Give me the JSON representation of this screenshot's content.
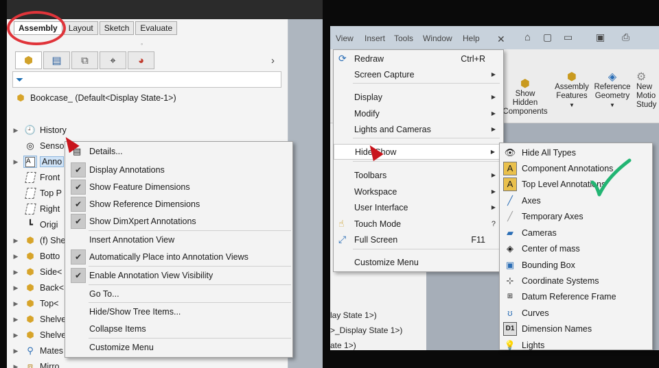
{
  "left": {
    "command_tabs": [
      "Assembly",
      "Layout",
      "Sketch",
      "Evaluate"
    ],
    "active_tab": "Assembly",
    "fm_tab_icons": [
      "feature-manager-icon",
      "property-manager-icon",
      "configuration-manager-icon",
      "dimxpert-manager-icon",
      "display-manager-icon"
    ],
    "root": "Bookcase_ (Default<Display State-1>)",
    "tree": [
      {
        "label": "History",
        "icon": "history-icon"
      },
      {
        "label": "Sensors",
        "icon": "sensors-icon"
      },
      {
        "label": "Anno",
        "icon": "annotations-icon"
      },
      {
        "label": "Front",
        "icon": "plane-icon"
      },
      {
        "label": "Top P",
        "icon": "plane-icon"
      },
      {
        "label": "Right",
        "icon": "plane-icon"
      },
      {
        "label": "Origi",
        "icon": "origin-icon"
      },
      {
        "label": "(f) She",
        "icon": "part-icon"
      },
      {
        "label": "Botto",
        "icon": "part-icon"
      },
      {
        "label": "Side<",
        "icon": "part-icon"
      },
      {
        "label": "Back<",
        "icon": "part-icon"
      },
      {
        "label": "Top<",
        "icon": "part-icon"
      },
      {
        "label": "Shelve",
        "icon": "part-icon"
      },
      {
        "label": "Shelve",
        "icon": "part-icon"
      },
      {
        "label": "Mates",
        "icon": "mates-icon"
      },
      {
        "label": "Mirro",
        "icon": "mirror-icon"
      }
    ],
    "context_menu": {
      "details": "Details...",
      "display_annotations": "Display Annotations",
      "show_feature_dimensions": "Show Feature Dimensions",
      "show_reference_dimensions": "Show Reference Dimensions",
      "show_dimxpert_annotations": "Show DimXpert Annotations",
      "insert_annotation_view": "Insert Annotation View",
      "auto_place": "Automatically Place into Annotation Views",
      "enable_visibility": "Enable Annotation View Visibility",
      "go_to": "Go To...",
      "hide_show_tree": "Hide/Show Tree Items...",
      "collapse": "Collapse Items",
      "customize": "Customize Menu"
    }
  },
  "right": {
    "menubar": [
      "View",
      "Insert",
      "Tools",
      "Window",
      "Help"
    ],
    "ribbon": {
      "show_hidden": [
        "Show",
        "Hidden",
        "Components"
      ],
      "assembly_features": [
        "Assembly",
        "Features"
      ],
      "reference_geometry": [
        "Reference",
        "Geometry"
      ],
      "new_motion": [
        "New",
        "Motio",
        "Study"
      ]
    },
    "tree_fragments": [
      "lay State 1>)",
      ">_Display State 1>)",
      "ate 1>)"
    ],
    "view_menu": {
      "redraw": "Redraw",
      "redraw_shortcut": "Ctrl+R",
      "screen_capture": "Screen Capture",
      "display": "Display",
      "modify": "Modify",
      "lights_cameras": "Lights and Cameras",
      "hide_show": "Hide/Show",
      "toolbars": "Toolbars",
      "workspace": "Workspace",
      "user_interface": "User Interface",
      "touch_mode": "Touch Mode",
      "full_screen": "Full Screen",
      "full_screen_shortcut": "F11",
      "customize_menu": "Customize Menu"
    },
    "submenu": [
      {
        "label": "Hide All Types",
        "icon": "eye-icon"
      },
      {
        "label": "Component Annotations",
        "icon": "component-annotations-icon"
      },
      {
        "label": "Top Level Annotations",
        "icon": "top-level-annotations-icon"
      },
      {
        "label": "Axes",
        "icon": "axes-icon"
      },
      {
        "label": "Temporary Axes",
        "icon": "temporary-axes-icon"
      },
      {
        "label": "Cameras",
        "icon": "camera-icon"
      },
      {
        "label": "Center of mass",
        "icon": "center-of-mass-icon"
      },
      {
        "label": "Bounding Box",
        "icon": "bounding-box-icon"
      },
      {
        "label": "Coordinate Systems",
        "icon": "coordinate-system-icon"
      },
      {
        "label": "Datum Reference Frame",
        "icon": "datum-reference-frame-icon"
      },
      {
        "label": "Curves",
        "icon": "curves-icon"
      },
      {
        "label": "Dimension Names",
        "icon": "dimension-names-icon"
      },
      {
        "label": "Lights",
        "icon": "lights-icon"
      }
    ],
    "dimension_names_badge": "D1"
  },
  "colors": {
    "highlight_circle": "#e0343a",
    "check_mark": "#22b573",
    "cursor": "#c8141c"
  }
}
